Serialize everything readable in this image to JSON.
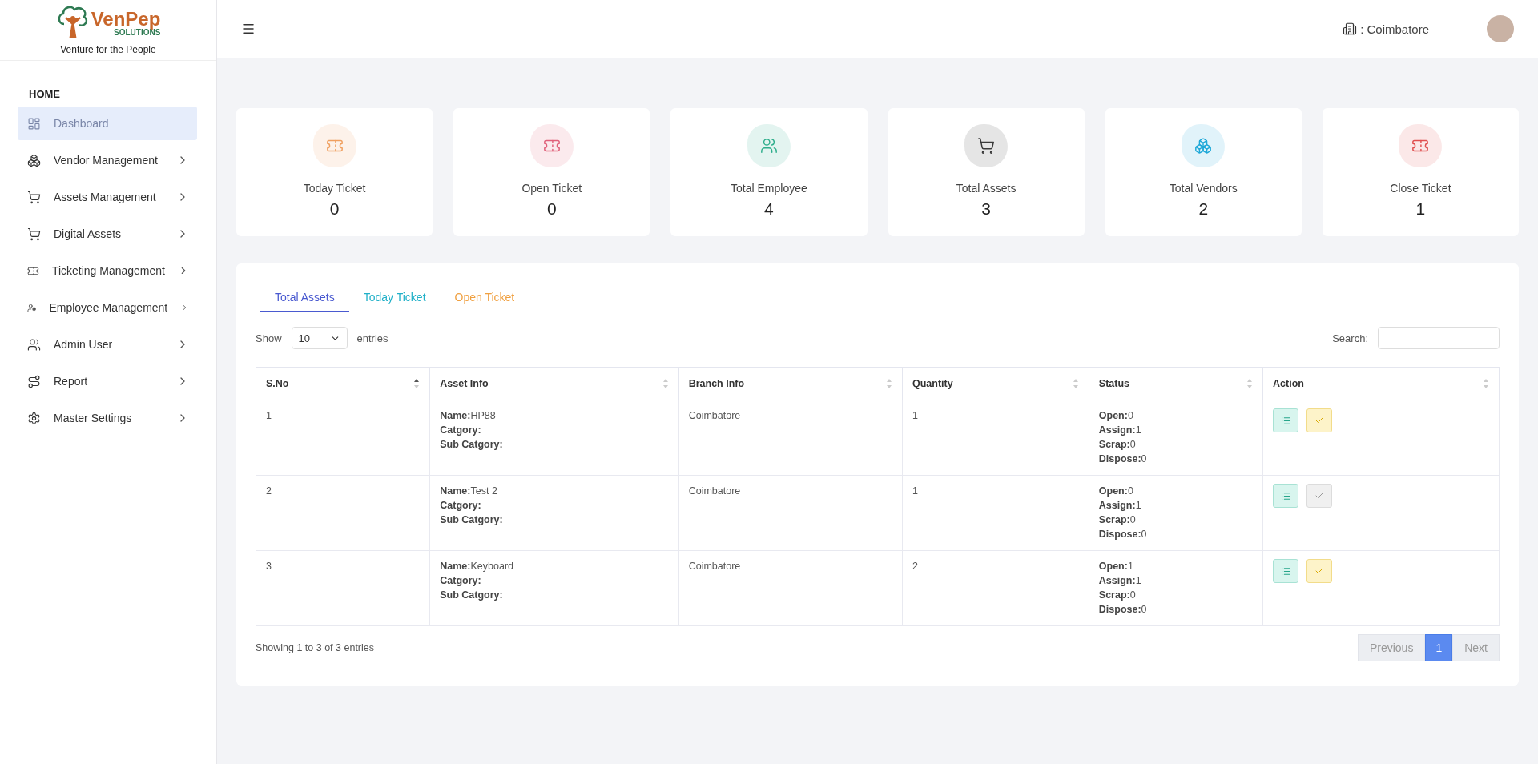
{
  "logo": {
    "name": "VenPep",
    "subtitle": "SOLUTIONS",
    "tagline": "Venture for the People"
  },
  "sidebar": {
    "section": "HOME",
    "items": [
      {
        "label": "Dashboard",
        "kind": "dashboard",
        "selected": true,
        "expandable": false
      },
      {
        "label": "Vendor Management",
        "kind": "boxes",
        "selected": false,
        "expandable": true
      },
      {
        "label": "Assets Management",
        "kind": "cart",
        "selected": false,
        "expandable": true
      },
      {
        "label": "Digital Assets",
        "kind": "cart",
        "selected": false,
        "expandable": true
      },
      {
        "label": "Ticketing Management",
        "kind": "ticket",
        "selected": false,
        "expandable": true
      },
      {
        "label": "Employee Management",
        "kind": "usercog",
        "selected": false,
        "expandable": true
      },
      {
        "label": "Admin User",
        "kind": "users",
        "selected": false,
        "expandable": true
      },
      {
        "label": "Report",
        "kind": "route",
        "selected": false,
        "expandable": true
      },
      {
        "label": "Master Settings",
        "kind": "settings",
        "selected": false,
        "expandable": true
      }
    ]
  },
  "header": {
    "branch": ": Coimbatore"
  },
  "cards": [
    {
      "label": "Today Ticket",
      "value": "0",
      "kind": "ticket",
      "color": "#f0a060"
    },
    {
      "label": "Open Ticket",
      "value": "0",
      "kind": "ticket",
      "color": "#e0607a"
    },
    {
      "label": "Total Employee",
      "value": "4",
      "kind": "users",
      "color": "#2fae8c"
    },
    {
      "label": "Total Assets",
      "value": "3",
      "kind": "cart",
      "color": "#3a3a3a"
    },
    {
      "label": "Total Vendors",
      "value": "2",
      "kind": "boxes",
      "color": "#1ea8d8"
    },
    {
      "label": "Close Ticket",
      "value": "1",
      "kind": "ticket",
      "color": "#e05050"
    }
  ],
  "tabs": [
    {
      "label": "Total Assets",
      "selected": true,
      "color": "#4a5ad0"
    },
    {
      "label": "Today Ticket",
      "selected": false,
      "color": "#20b0c8"
    },
    {
      "label": "Open Ticket",
      "selected": false,
      "color": "#f0a040"
    }
  ],
  "table_controls": {
    "show": "Show",
    "page_size": "10",
    "entries": "entries",
    "search_label": "Search:"
  },
  "table": {
    "columns": [
      {
        "label": "S.No",
        "sorted": true
      },
      {
        "label": "Asset Info",
        "sorted": false
      },
      {
        "label": "Branch Info",
        "sorted": false
      },
      {
        "label": "Quantity",
        "sorted": false
      },
      {
        "label": "Status",
        "sorted": false
      },
      {
        "label": "Action",
        "sorted": false
      }
    ],
    "rows": [
      {
        "sno": "1",
        "asset_info": [
          "**Name:**HP88",
          "**Catgory:**",
          "**Sub Catgory:**"
        ],
        "branch": "Coimbatore",
        "quantity": "1",
        "status": [
          "**Open:**0",
          "**Assign:**1",
          "**Scrap:**0",
          "**Dispose:**0"
        ],
        "approve_enabled": true
      },
      {
        "sno": "2",
        "asset_info": [
          "**Name:**Test 2",
          "**Catgory:**",
          "**Sub Catgory:**"
        ],
        "branch": "Coimbatore",
        "quantity": "1",
        "status": [
          "**Open:**0",
          "**Assign:**1",
          "**Scrap:**0",
          "**Dispose:**0"
        ],
        "approve_enabled": false
      },
      {
        "sno": "3",
        "asset_info": [
          "**Name:**Keyboard",
          "**Catgory:**",
          "**Sub Catgory:**"
        ],
        "branch": "Coimbatore",
        "quantity": "2",
        "status": [
          "**Open:**1",
          "**Assign:**1",
          "**Scrap:**0",
          "**Dispose:**0"
        ],
        "approve_enabled": true
      }
    ]
  },
  "footer": {
    "info": "Showing 1 to 3 of 3 entries",
    "pagination": [
      {
        "label": "Previous",
        "selected": false,
        "disabled": true
      },
      {
        "label": "1",
        "selected": true,
        "disabled": false
      },
      {
        "label": "Next",
        "selected": false,
        "disabled": true
      }
    ]
  }
}
